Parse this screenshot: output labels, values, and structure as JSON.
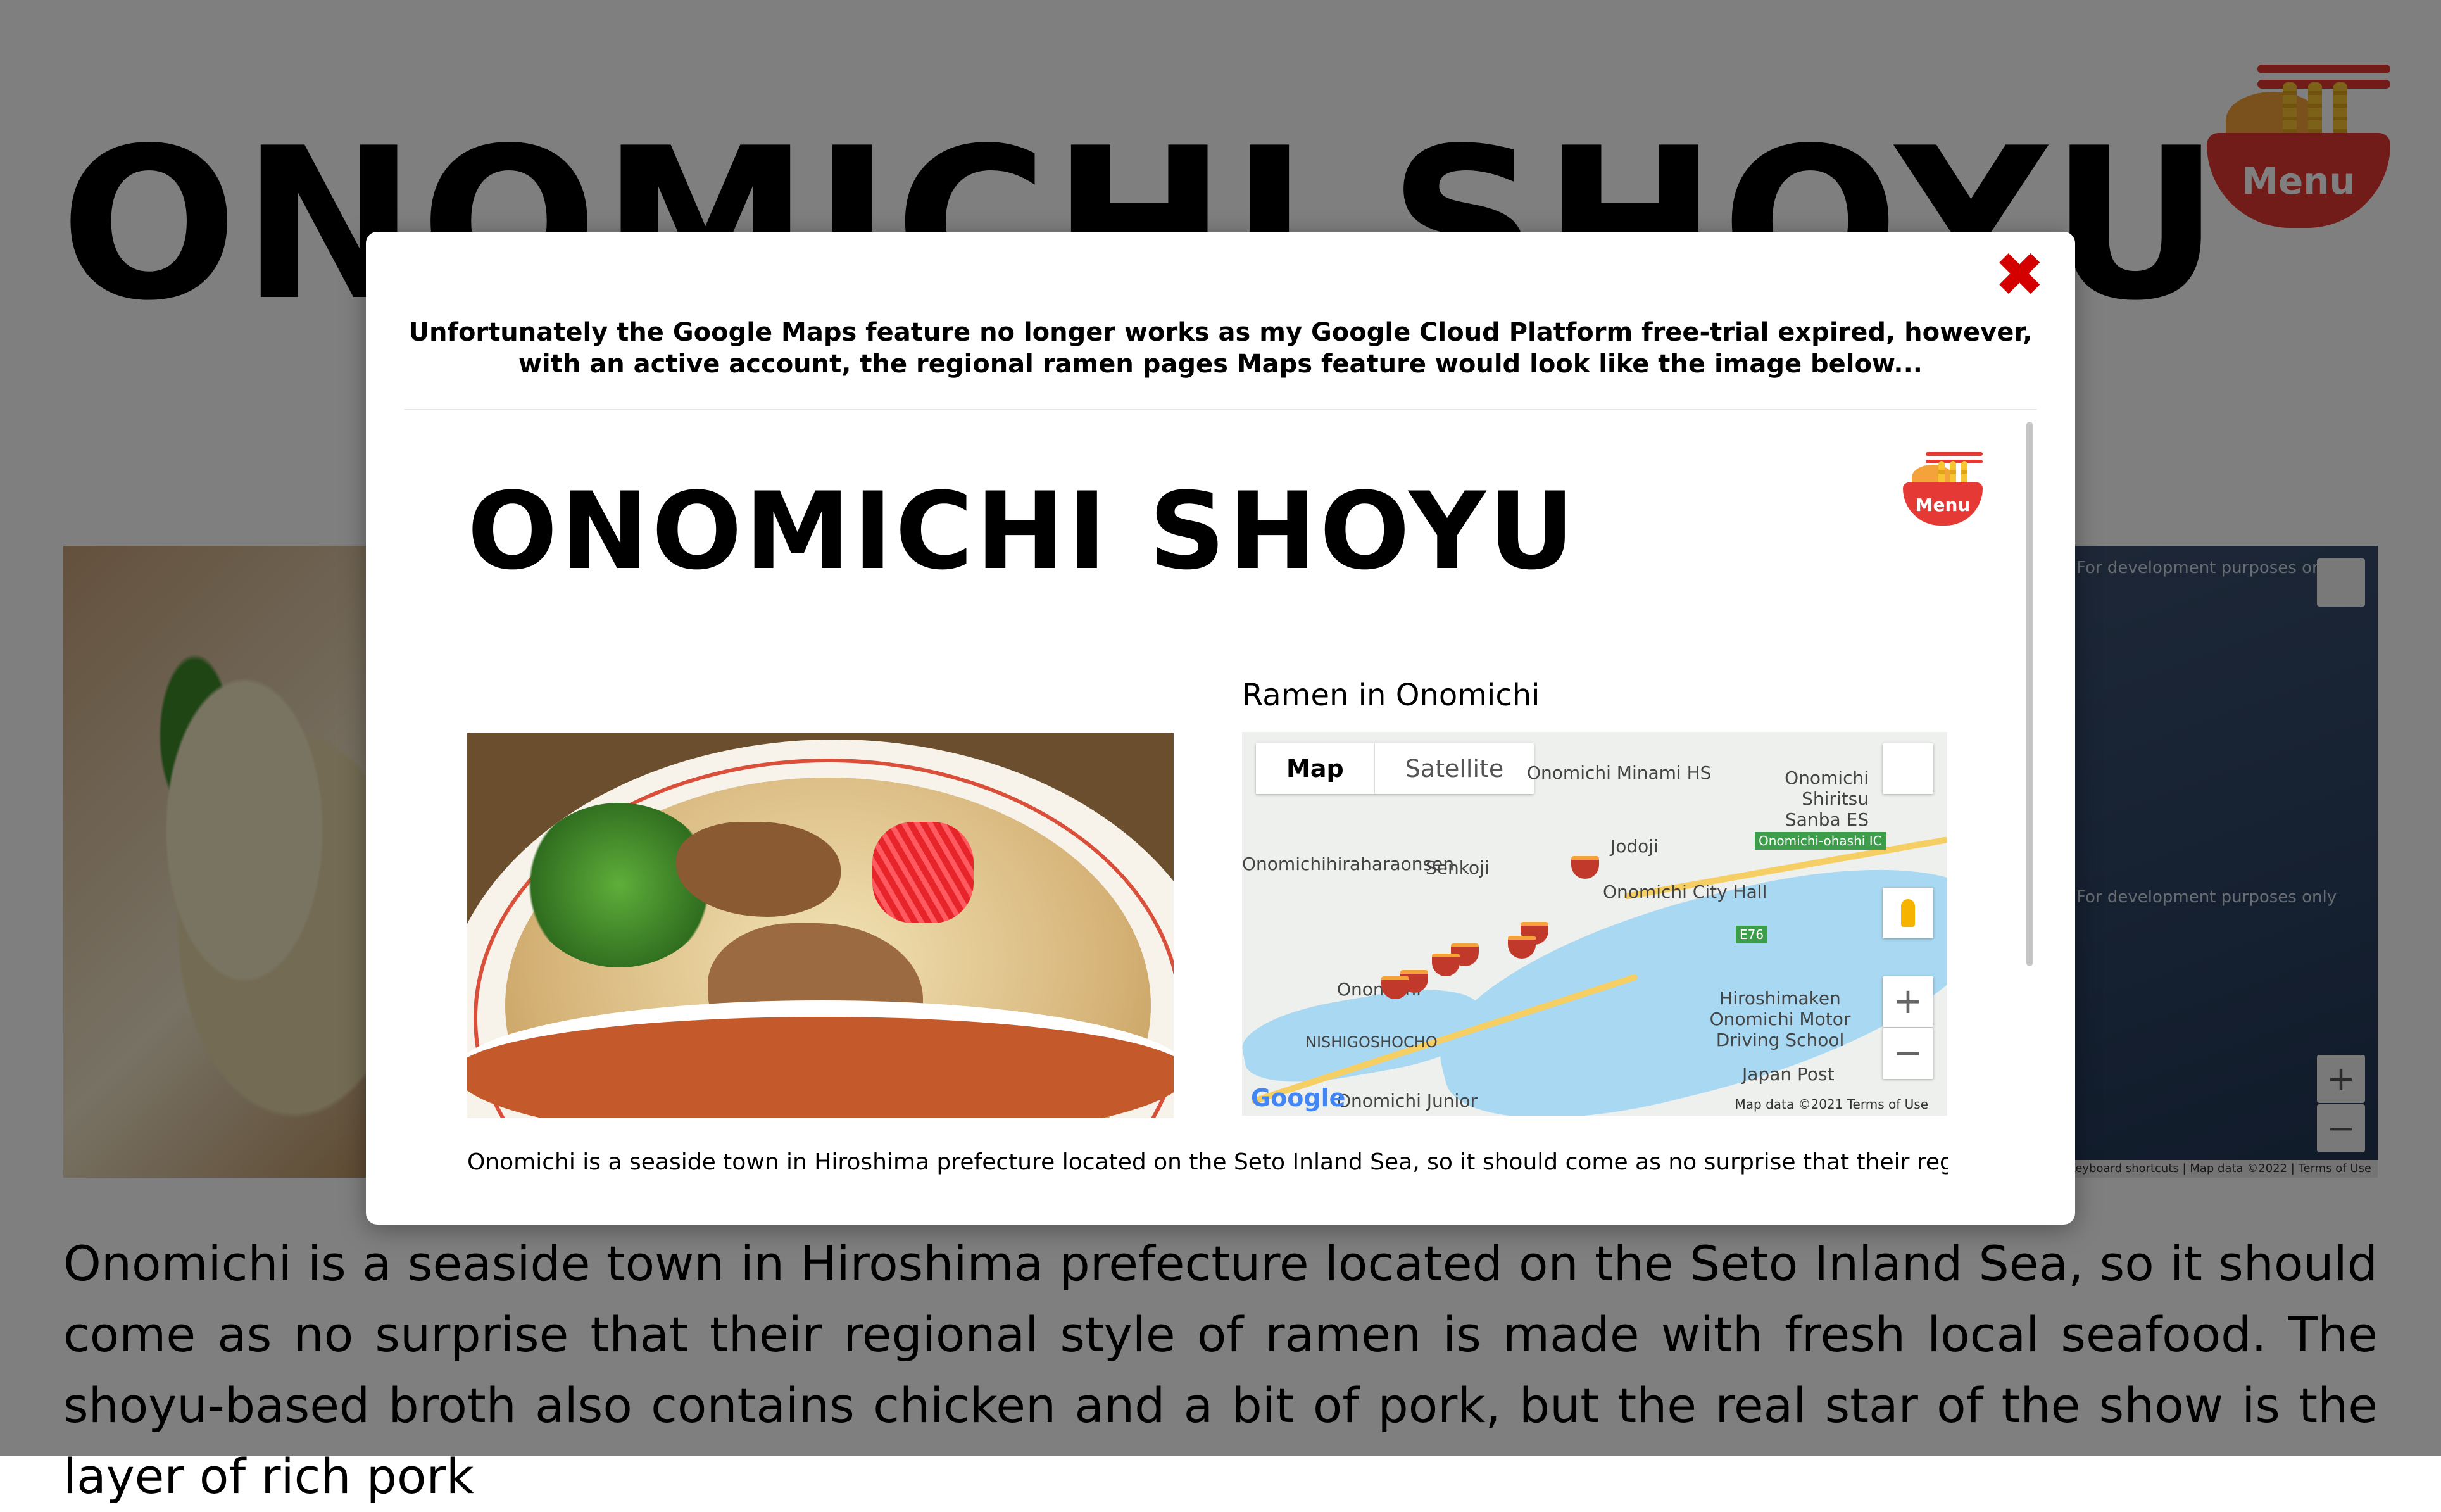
{
  "background": {
    "page_title": "ONOMICHI SHOYU",
    "menu_label": "Menu",
    "map": {
      "dev_notice": "For development purposes only",
      "footer": "Keyboard shortcuts  |  Map data ©2022  |  Terms of Use"
    },
    "body_text": "Onomichi is a seaside town in Hiroshima prefecture located on the Seto Inland Sea, so it should come as no surprise that their regional style of ramen is made with fresh local seafood. The shoyu-based broth also contains chicken and a bit of pork, but the real star of the show is the layer of rich pork"
  },
  "modal": {
    "close_symbol": "✖",
    "notice": "Unfortunately the Google Maps feature no longer works as my Google Cloud Platform free-trial expired, however, with an active account, the regional ramen pages Maps feature would look like the image below...",
    "preview": {
      "page_title": "ONOMICHI SHOYU",
      "menu_label": "Menu",
      "map_heading": "Ramen in Onomichi",
      "map": {
        "tab_map": "Map",
        "tab_satellite": "Satellite",
        "zoom_in": "+",
        "zoom_out": "−",
        "labels": {
          "minami_hs": "Onomichi Minami HS",
          "shiritsu": "Onomichi Shiritsu Sanba ES",
          "jodoji": "Jodoji",
          "ohashi": "Onomichi-ohashi IC",
          "hiraharaonsen": "Onomichihiraharaonsen",
          "senkoji": "Senkoji",
          "city_hall": "Onomichi City Hall",
          "e76": "E76",
          "driving_school": "Hiroshimaken Onomichi Motor Driving School",
          "nishigosho": "NISHIGOSHOCHO",
          "japan_post": "Japan Post",
          "junior": "Onomichi Junior",
          "onomichi": "Onomichi"
        },
        "google_logo": "Google",
        "attribution": "Map data ©2021   Terms of Use"
      },
      "body_text": "Onomichi is a seaside town in Hiroshima prefecture located on the Seto Inland Sea, so it should come as no surprise that their regional"
    }
  }
}
